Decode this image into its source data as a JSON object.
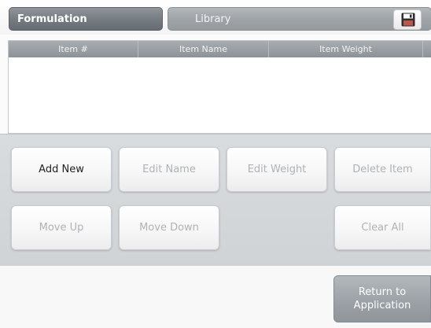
{
  "tabs": {
    "formulation": "Formulation",
    "library": "Library"
  },
  "toolbar": {
    "save_icon": "floppy-disk-icon"
  },
  "table": {
    "columns": [
      "Item #",
      "Item Name",
      "Item Weight"
    ],
    "rows": []
  },
  "buttons": {
    "add_new": "Add New",
    "edit_name": "Edit Name",
    "edit_weight": "Edit Weight",
    "delete_item": "Delete Item",
    "move_up": "Move Up",
    "move_down": "Move Down",
    "clear_all": "Clear All",
    "return": "Return to\nApplication"
  },
  "colors": {
    "active_text": "#222222",
    "disabled_text": "#aeb3b7",
    "header_gray": "#737a80"
  }
}
